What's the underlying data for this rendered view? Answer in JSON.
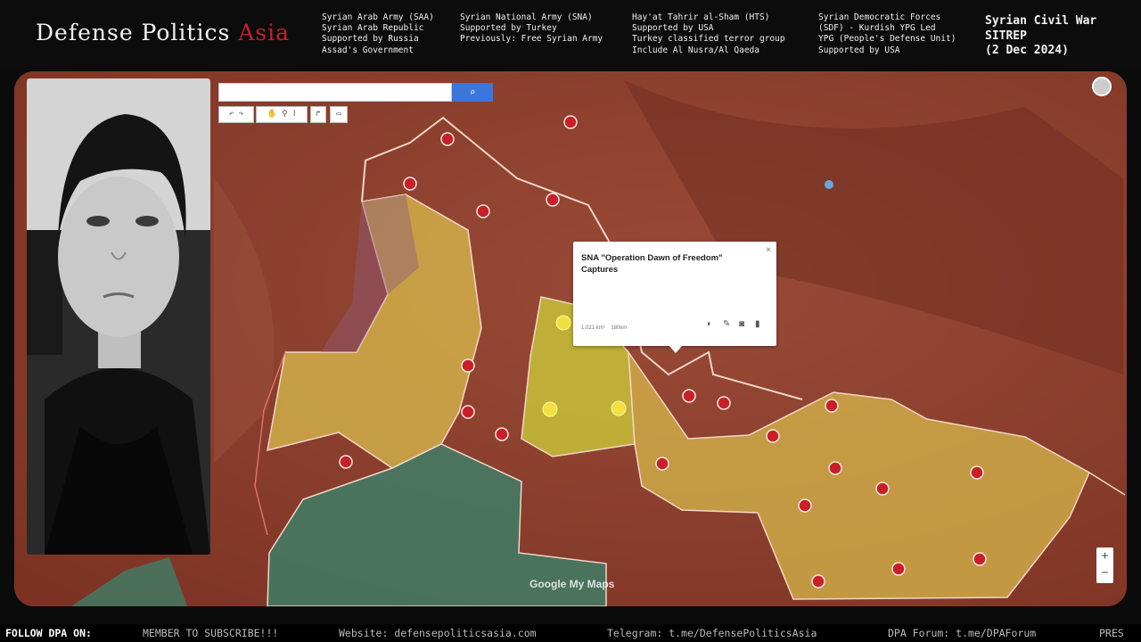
{
  "header": {
    "logo_main": "Defense Politics",
    "logo_accent": "Asia",
    "logo_sub": "",
    "legend": [
      {
        "lines": [
          "Syrian Arab Army (SAA)",
          "Syrian Arab Republic",
          "Supported by Russia",
          "Assad's Government"
        ]
      },
      {
        "lines": [
          "Syrian National Army (SNA)",
          "Supported by Turkey",
          "Previously: Free Syrian Army"
        ]
      },
      {
        "lines": [
          "Hay'at Tahrir al-Sham (HTS)",
          "Supported by USA",
          "Turkey classified terror group",
          "Include Al Nusra/Al Qaeda"
        ]
      },
      {
        "lines": [
          "Syrian Democratic Forces",
          "(SDF) - Kurdish YPG Led",
          "YPG (People's Defense Unit)",
          "Supported by USA"
        ]
      }
    ],
    "sitrep": [
      "Syrian Civil War",
      "SITREP",
      "(2 Dec 2024)"
    ]
  },
  "map": {
    "search": {
      "placeholder": "",
      "button_icon": "search-icon"
    },
    "popup": {
      "title": "SNA \"Operation Dawn of Freedom\" Captures",
      "meta_area": "1,021 km²",
      "meta_perimeter": "180km",
      "icons": [
        "style-icon",
        "edit-icon",
        "camera-icon",
        "delete-icon"
      ]
    },
    "zoom_in": "+",
    "zoom_out": "−",
    "attribution": "Google My Maps",
    "colors": {
      "terrain": "#8a3a2a",
      "sna_zone": "#d8bd4c",
      "sna_new_capture": "#c8c23a",
      "sdf_zone": "#3f7d66",
      "border_line": "#f2c8c0"
    }
  },
  "ticker": {
    "follow": "FOLLOW DPA ON:",
    "items": [
      "MEMBER TO SUBSCRIBE!!!",
      "Website: defensepoliticsasia.com",
      "Telegram: t.me/DefensePoliticsAsia",
      "DPA Forum: t.me/DPAForum",
      "PRES"
    ]
  }
}
